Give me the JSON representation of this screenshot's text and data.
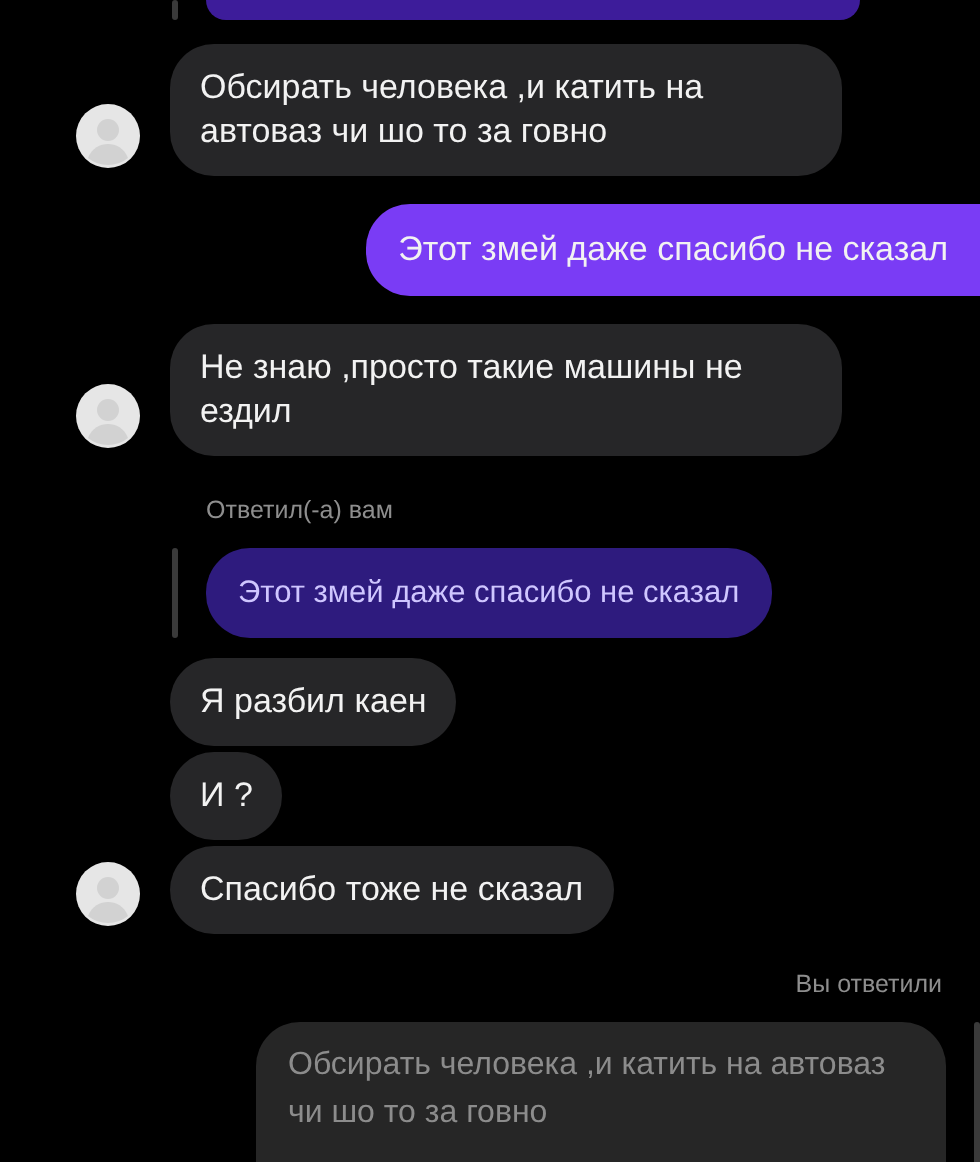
{
  "messages": [
    {
      "kind": "cut-quote"
    },
    {
      "kind": "incoming",
      "text": "Обсирать человека ,и катить на автоваз чи шо то за говно",
      "avatar": true
    },
    {
      "kind": "outgoing",
      "text": "Этот змей даже спасибо не сказал"
    },
    {
      "kind": "incoming",
      "text": "Не знаю ,просто такие машины не ездил",
      "avatar": true
    },
    {
      "kind": "reply-note-in",
      "text": "Ответил(-а) вам"
    },
    {
      "kind": "quote-in",
      "text": "Этот змей даже спасибо не сказал"
    },
    {
      "kind": "incoming",
      "text": "Я разбил каен",
      "avatar": false
    },
    {
      "kind": "incoming",
      "text": "И ?",
      "avatar": false
    },
    {
      "kind": "incoming",
      "text": "Спасибо тоже не сказал",
      "avatar": true
    },
    {
      "kind": "reply-note-out",
      "text": "Вы ответили"
    },
    {
      "kind": "quote-out",
      "text": "Обсирать человека ,и катить на автоваз чи шо то за говно"
    }
  ]
}
